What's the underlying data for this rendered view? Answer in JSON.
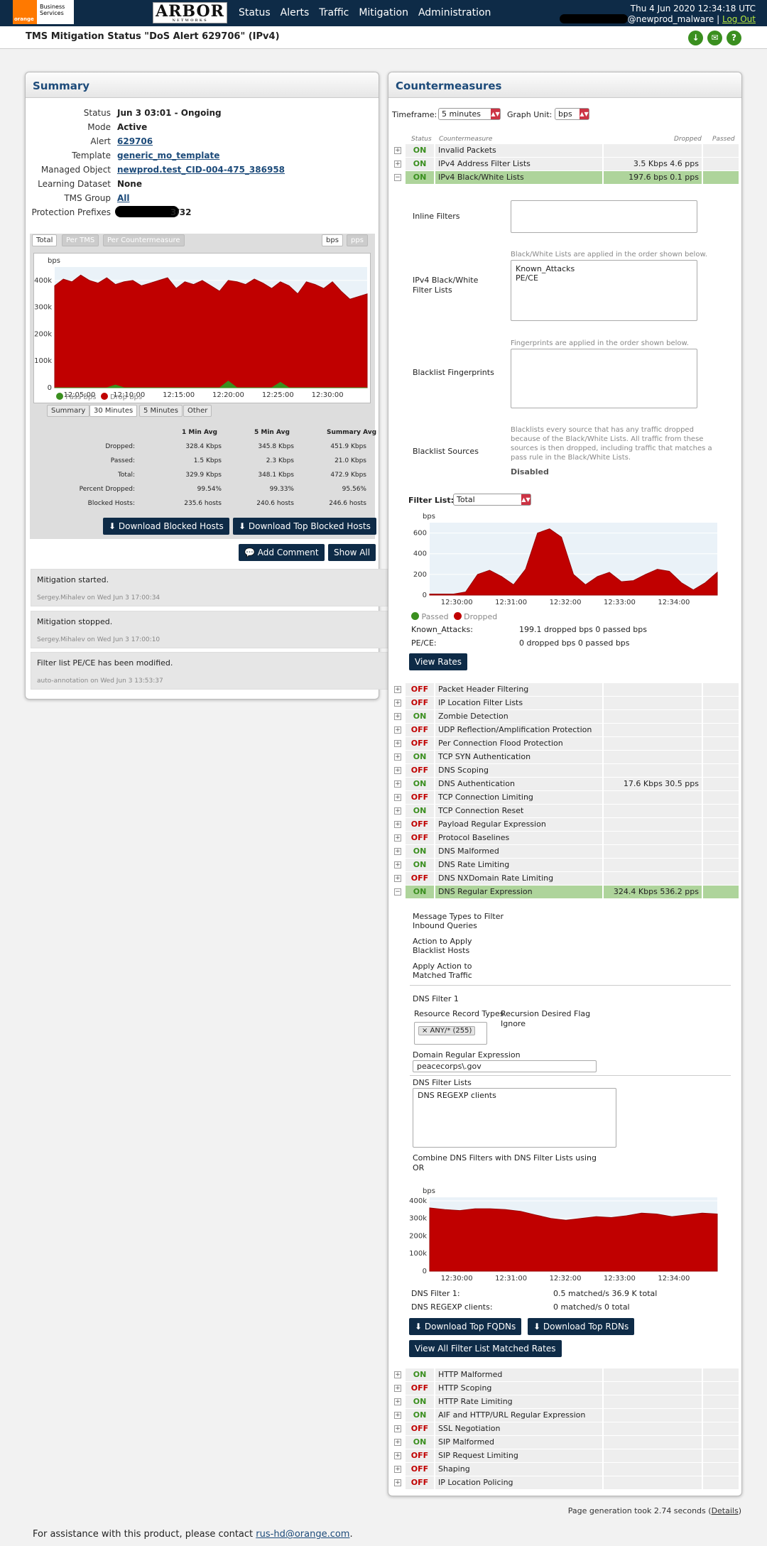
{
  "header": {
    "brand_line1": "Business",
    "brand_line2": "Services",
    "brand_mark": "orange",
    "arbor_logo": "ARBOR",
    "arbor_sub": "NETWORKS",
    "nav": [
      "Status",
      "Alerts",
      "Traffic",
      "Mitigation",
      "Administration"
    ],
    "datetime": "Thu 4 Jun 2020 12:34:18 UTC",
    "user": "@newprod_malware",
    "separator": "|",
    "logout": "Log Out"
  },
  "title": "TMS Mitigation Status \"DoS Alert 629706\" (IPv4)",
  "title_icons": [
    "download-icon",
    "mail-icon",
    "help-icon"
  ],
  "summary": {
    "heading": "Summary",
    "fields": [
      {
        "label": "Status",
        "value": "Jun 3 03:01 - Ongoing"
      },
      {
        "label": "Mode",
        "value": "Active"
      },
      {
        "label": "Alert",
        "value": "629706"
      },
      {
        "label": "Template",
        "value": "generic_mo_template"
      },
      {
        "label": "Managed Object",
        "value": "newprod.test_CID-004-475_386958"
      },
      {
        "label": "Learning Dataset",
        "value": "None"
      },
      {
        "label": "TMS Group",
        "value": "All"
      },
      {
        "label": "Protection Prefixes",
        "value": "3/32"
      }
    ],
    "tabs": [
      "Total",
      "Per TMS",
      "Per Countermeasure"
    ],
    "units": [
      "bps",
      "pps"
    ],
    "chart_ylabel": "bps",
    "range_tabs": [
      "Summary",
      "30 Minutes",
      "5 Minutes",
      "Other"
    ],
    "stats_headers": [
      "1 Min Avg",
      "5 Min Avg",
      "Summary Avg"
    ],
    "stats": [
      {
        "label": "Dropped:",
        "v": [
          "328.4 Kbps",
          "345.8 Kbps",
          "451.9 Kbps"
        ]
      },
      {
        "label": "Passed:",
        "v": [
          "1.5 Kbps",
          "2.3 Kbps",
          "21.0 Kbps"
        ]
      },
      {
        "label": "Total:",
        "v": [
          "329.9 Kbps",
          "348.1 Kbps",
          "472.9 Kbps"
        ]
      },
      {
        "label": "Percent Dropped:",
        "v": [
          "99.54%",
          "99.33%",
          "95.56%"
        ]
      },
      {
        "label": "Blocked Hosts:",
        "v": [
          "235.6  hosts",
          "240.6  hosts",
          "246.6  hosts"
        ]
      }
    ],
    "btn_download_blocked": "Download Blocked Hosts",
    "btn_download_top_blocked": "Download Top Blocked Hosts",
    "btn_add_comment": "Add Comment",
    "btn_show_all": "Show All",
    "notes": [
      {
        "text": "Mitigation started.",
        "meta": "Sergey.Mihalev on Wed Jun 3 17:00:34"
      },
      {
        "text": "Mitigation stopped.",
        "meta": "Sergey.Mihalev on Wed Jun 3 17:00:10"
      },
      {
        "text": "Filter list PE/CE has been modified.",
        "meta": "auto-annotation on Wed Jun 3 13:53:37"
      }
    ]
  },
  "chart_data": [
    {
      "type": "area",
      "ylabel": "bps",
      "ylim": [
        0,
        450000
      ],
      "yticks": [
        "0",
        "100k",
        "200k",
        "300k",
        "400k"
      ],
      "xticks": [
        "12:05:00",
        "12:10:00",
        "12:15:00",
        "12:20:00",
        "12:25:00",
        "12:30:00"
      ],
      "legend": [
        "Pass bps",
        "Drop bps"
      ],
      "colors": {
        "pass": "#3a8f1f",
        "drop": "#c00000"
      },
      "series": [
        {
          "name": "Drop bps",
          "values": [
            380000,
            405000,
            395000,
            420000,
            400000,
            390000,
            410000,
            385000,
            395000,
            400000,
            380000,
            390000,
            400000,
            410000,
            370000,
            395000,
            385000,
            400000,
            380000,
            360000,
            400000,
            395000,
            385000,
            405000,
            390000,
            370000,
            395000,
            380000,
            350000,
            395000,
            385000,
            370000,
            395000,
            360000,
            330000,
            340000,
            350000
          ]
        },
        {
          "name": "Pass bps",
          "values": [
            0,
            0,
            0,
            0,
            0,
            0,
            0,
            10000,
            0,
            0,
            0,
            0,
            0,
            0,
            0,
            0,
            0,
            0,
            0,
            0,
            25000,
            0,
            0,
            0,
            0,
            0,
            20000,
            0,
            0,
            0,
            0,
            0,
            0,
            0,
            0,
            0,
            0
          ]
        }
      ]
    },
    {
      "type": "area",
      "ylabel": "bps",
      "ylim": [
        0,
        700
      ],
      "yticks": [
        "0",
        "200",
        "400",
        "600"
      ],
      "xticks": [
        "12:30:00",
        "12:31:00",
        "12:32:00",
        "12:33:00",
        "12:34:00"
      ],
      "legend": [
        "Passed",
        "Dropped"
      ],
      "series": [
        {
          "name": "Dropped",
          "values": [
            10,
            10,
            10,
            30,
            200,
            240,
            180,
            100,
            250,
            600,
            640,
            560,
            200,
            100,
            180,
            220,
            130,
            140,
            200,
            250,
            230,
            120,
            50,
            120,
            220
          ]
        }
      ]
    },
    {
      "type": "area",
      "ylabel": "bps",
      "ylim": [
        0,
        420000
      ],
      "yticks": [
        "0",
        "100k",
        "200k",
        "300k",
        "400k"
      ],
      "xticks": [
        "12:30:00",
        "12:31:00",
        "12:32:00",
        "12:33:00",
        "12:34:00"
      ],
      "series": [
        {
          "name": "",
          "values": [
            360000,
            350000,
            345000,
            355000,
            355000,
            350000,
            340000,
            320000,
            300000,
            290000,
            300000,
            310000,
            305000,
            315000,
            330000,
            325000,
            310000,
            320000,
            330000,
            325000
          ]
        }
      ]
    }
  ],
  "countermeasures": {
    "heading": "Countermeasures",
    "timeframe_label": "Timeframe:",
    "timeframe_value": "5 minutes",
    "graph_unit_label": "Graph Unit:",
    "graph_unit_value": "bps",
    "col_status": "Status",
    "col_cm": "Countermeasure",
    "col_dropped": "Dropped",
    "col_passed": "Passed",
    "rows_top": [
      {
        "status": "ON",
        "name": "Invalid Packets",
        "dropped": ""
      },
      {
        "status": "ON",
        "name": "IPv4 Address Filter Lists",
        "dropped": "3.5 Kbps 4.6 pps"
      },
      {
        "status": "ON",
        "name": "IPv4 Black/White Lists",
        "dropped": "197.6 bps 0.1 pps"
      }
    ],
    "bw": {
      "inline_filters": "Inline Filters",
      "bw_label": "IPv4 Black/White Filter Lists",
      "bw_hint": "Black/White Lists are applied in the order shown below.",
      "bw_items": [
        "Known_Attacks",
        "PE/CE"
      ],
      "fp_label": "Blacklist Fingerprints",
      "fp_hint": "Fingerprints are applied in the order shown below.",
      "src_label": "Blacklist Sources",
      "src_hint": "Blacklists every source that has any traffic dropped because of the Black/White Lists. All traffic from these sources is then dropped, including traffic that matches a pass rule in the Black/White Lists.",
      "src_value": "Disabled",
      "filter_list_label": "Filter List:",
      "filter_list_value": "Total",
      "legend_pass": "Passed",
      "legend_drop": "Dropped",
      "rates": [
        {
          "name": "Known_Attacks:",
          "text": "199.1  dropped bps  0  passed bps"
        },
        {
          "name": "PE/CE:",
          "text": "0  dropped bps  0  passed bps"
        }
      ],
      "view_rates": "View Rates"
    },
    "rows_mid": [
      {
        "status": "OFF",
        "name": "Packet Header Filtering",
        "dropped": ""
      },
      {
        "status": "OFF",
        "name": "IP Location Filter Lists",
        "dropped": ""
      },
      {
        "status": "ON",
        "name": "Zombie Detection",
        "dropped": ""
      },
      {
        "status": "OFF",
        "name": "UDP Reflection/Amplification Protection",
        "dropped": ""
      },
      {
        "status": "OFF",
        "name": "Per Connection Flood Protection",
        "dropped": ""
      },
      {
        "status": "ON",
        "name": "TCP SYN Authentication",
        "dropped": ""
      },
      {
        "status": "OFF",
        "name": "DNS Scoping",
        "dropped": ""
      },
      {
        "status": "ON",
        "name": "DNS Authentication",
        "dropped": "17.6 Kbps 30.5 pps"
      },
      {
        "status": "OFF",
        "name": "TCP Connection Limiting",
        "dropped": ""
      },
      {
        "status": "ON",
        "name": "TCP Connection Reset",
        "dropped": ""
      },
      {
        "status": "OFF",
        "name": "Payload Regular Expression",
        "dropped": ""
      },
      {
        "status": "OFF",
        "name": "Protocol Baselines",
        "dropped": ""
      },
      {
        "status": "ON",
        "name": "DNS Malformed",
        "dropped": ""
      },
      {
        "status": "ON",
        "name": "DNS Rate Limiting",
        "dropped": ""
      },
      {
        "status": "OFF",
        "name": "DNS NXDomain Rate Limiting",
        "dropped": ""
      },
      {
        "status": "ON",
        "name": "DNS Regular Expression",
        "dropped": "324.4 Kbps 536.2 pps"
      }
    ],
    "dns": {
      "msg_types": "Message Types to Filter Inbound Queries",
      "action": "Action to Apply Blacklist Hosts",
      "apply_action": "Apply Action to Matched Traffic",
      "filter_title": "DNS Filter 1",
      "rrt_label": "Resource Record Types",
      "rrt_tag": "× ANY/* (255)",
      "rdf_label": "Recursion Desired Flag",
      "rdf_value": "Ignore",
      "dre_label": "Domain Regular Expression",
      "dre_value": "peacecorps\\.gov",
      "dfl_label": "DNS Filter Lists",
      "dfl_value": "DNS REGEXP clients",
      "combine_label": "Combine DNS Filters with DNS Filter Lists using",
      "combine_value": "OR",
      "matched": [
        {
          "name": "DNS Filter 1:",
          "text": "0.5  matched/s  36.9 K total"
        },
        {
          "name": "DNS REGEXP clients:",
          "text": "0  matched/s  0  total"
        }
      ],
      "btn_fqdn": "Download Top FQDNs",
      "btn_rdn": "Download Top RDNs",
      "btn_view_all": "View All Filter List Matched Rates"
    },
    "rows_bottom": [
      {
        "status": "ON",
        "name": "HTTP Malformed",
        "dropped": ""
      },
      {
        "status": "OFF",
        "name": "HTTP Scoping",
        "dropped": ""
      },
      {
        "status": "ON",
        "name": "HTTP Rate Limiting",
        "dropped": ""
      },
      {
        "status": "ON",
        "name": "AIF and HTTP/URL Regular Expression",
        "dropped": ""
      },
      {
        "status": "OFF",
        "name": "SSL Negotiation",
        "dropped": ""
      },
      {
        "status": "ON",
        "name": "SIP Malformed",
        "dropped": ""
      },
      {
        "status": "OFF",
        "name": "SIP Request Limiting",
        "dropped": ""
      },
      {
        "status": "OFF",
        "name": "Shaping",
        "dropped": ""
      },
      {
        "status": "OFF",
        "name": "IP Location Policing",
        "dropped": ""
      }
    ]
  },
  "footer": {
    "gen_prefix": "Page generation took 2.74 seconds (",
    "gen_link": "Details",
    "gen_suffix": ")",
    "help_prefix": "For assistance with this product, please contact ",
    "help_email": "rus-hd@orange.com",
    "help_suffix": "."
  }
}
